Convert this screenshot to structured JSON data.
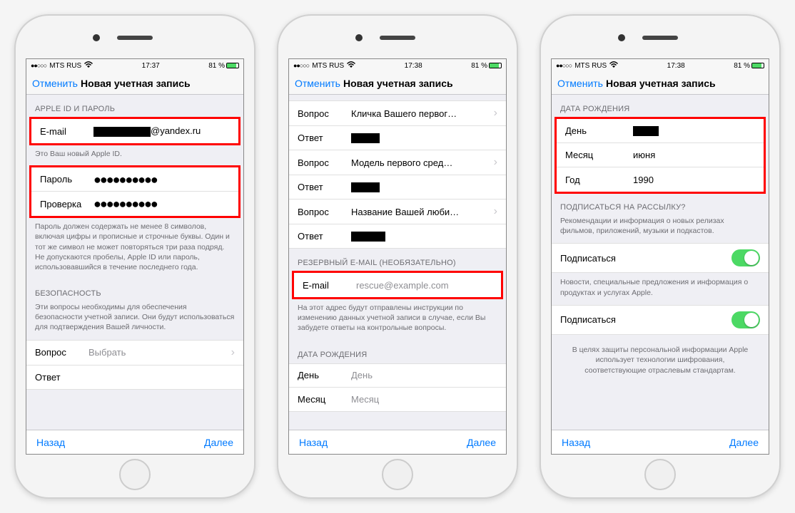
{
  "status": {
    "carrier": "MTS RUS",
    "time1": "17:37",
    "time2": "17:38",
    "time3": "17:38",
    "battery": "81 %"
  },
  "nav": {
    "cancel": "Отменить",
    "title": "Новая учетная запись"
  },
  "screen1": {
    "section_id": "APPLE ID И ПАРОЛЬ",
    "email_label": "E-mail",
    "email_suffix": "@yandex.ru",
    "email_footer": "Это Ваш новый Apple ID.",
    "password_label": "Пароль",
    "verify_label": "Проверка",
    "password_footer": "Пароль должен содержать не менее 8 символов, включая цифры и прописные и строчные буквы. Один и тот же символ не может повторяться три раза подряд. Не допускаются пробелы, Apple ID или пароль, использовавшийся в течение последнего года.",
    "section_security": "БЕЗОПАСНОСТЬ",
    "security_footer": "Эти вопросы необходимы для обеспечения безопасности учетной записи. Они будут использоваться для подтверждения Вашей личности.",
    "question_label": "Вопрос",
    "question_value": "Выбрать",
    "answer_label": "Ответ"
  },
  "screen2": {
    "question_label": "Вопрос",
    "answer_label": "Ответ",
    "q1": "Кличка Вашего первог…",
    "q2": "Модель первого сред…",
    "q3": "Название Вашей люби…",
    "section_rescue": "РЕЗЕРВНЫЙ E-MAIL (НЕОБЯЗАТЕЛЬНО)",
    "email_label": "E-mail",
    "email_placeholder": "rescue@example.com",
    "rescue_footer": "На этот адрес будут отправлены инструкции по изменению данных учетной записи в случае, если Вы забудете ответы на контрольные вопросы.",
    "section_birth": "ДАТА РОЖДЕНИЯ",
    "day_label": "День",
    "day_placeholder": "День",
    "month_label": "Месяц",
    "month_placeholder": "Месяц"
  },
  "screen3": {
    "section_birth": "ДАТА РОЖДЕНИЯ",
    "day_label": "День",
    "month_label": "Месяц",
    "month_value": "июня",
    "year_label": "Год",
    "year_value": "1990",
    "section_subscribe": "ПОДПИСАТЬСЯ НА РАССЫЛКУ?",
    "sub1_footer": "Рекомендации и информация о новых релизах фильмов, приложений, музыки и подкастов.",
    "subscribe_label": "Подписаться",
    "sub2_footer": "Новости, специальные предложения и информация о продуктах и услугах Apple.",
    "privacy_footer": "В целях защиты персональной информации Apple использует технологии шифрования, соответствующие отраслевым стандартам."
  },
  "bottom": {
    "back": "Назад",
    "next": "Далее"
  }
}
